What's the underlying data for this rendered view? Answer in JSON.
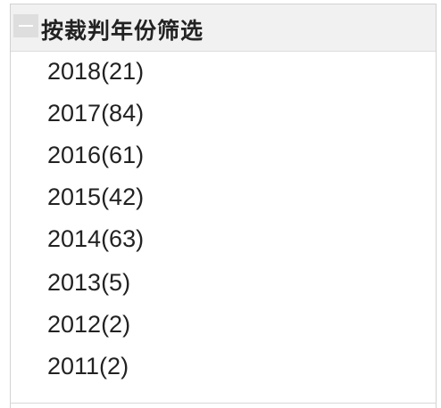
{
  "filter_panel": {
    "title": "按裁判年份筛选",
    "toggle_icon": "minus-icon",
    "items": [
      {
        "label": "2018(21)"
      },
      {
        "label": "2017(84)"
      },
      {
        "label": "2016(61)"
      },
      {
        "label": "2015(42)"
      },
      {
        "label": "2014(63)"
      },
      {
        "label": "2013(5)"
      },
      {
        "label": "2012(2)"
      },
      {
        "label": "2011(2)"
      }
    ]
  }
}
